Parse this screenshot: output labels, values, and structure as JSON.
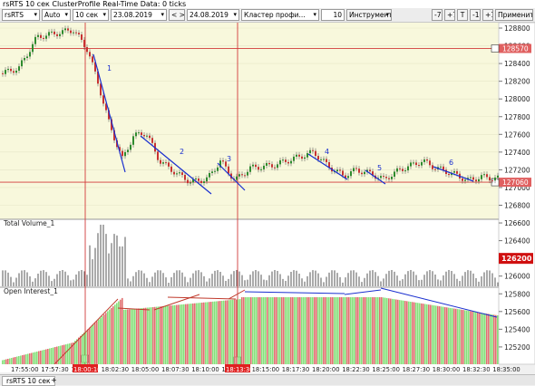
{
  "window": {
    "title": "rsRTS 10 сек ClusterProfile Real-Time Data: 0 ticks"
  },
  "toolbar": {
    "instrument": "rsRTS",
    "mode": "Auto",
    "timeframe": "10 сек",
    "date_from": "23.08.2019",
    "nav": "< >",
    "date_to": "24.08.2019",
    "indicator": "Кластер профи...",
    "count": "10",
    "tools_label": "Инструменты",
    "btn_minus7": "-7",
    "btn_plus7": "+7",
    "btn_t": "T",
    "btn_minus1": "-1",
    "btn_plus1": "+1",
    "apply_label": "Применить"
  },
  "chart": {
    "price_labels": [
      "128800",
      "128600",
      "128400",
      "128200",
      "128000",
      "127800",
      "127600",
      "127400",
      "127200",
      "127000",
      "126800",
      "126600",
      "126400",
      "126200",
      "126000",
      "125800",
      "125600",
      "125400",
      "125200"
    ],
    "price_values": [
      128800,
      128600,
      128400,
      128200,
      128000,
      127800,
      127600,
      127400,
      127200,
      127000,
      126800,
      126600,
      126400,
      126200,
      126000,
      125800,
      125600,
      125400,
      125200
    ],
    "highlight_upper": "128570",
    "highlight_upper_value": 128570,
    "highlight_lower": "127060",
    "highlight_lower_value": 127060,
    "highlight_volume": "126200",
    "price_line_color": "#d23a3a",
    "panel_volume_label": "Total Volume_1",
    "panel_oi_label": "Open Interest_1",
    "trend_labels": [
      "1",
      "2",
      "3",
      "4",
      "5",
      "6"
    ],
    "time_labels": [
      "17:55:00",
      "17:57:30",
      "18:00:10",
      "18:02:30",
      "18:05:00",
      "18:07:30",
      "18:10:00",
      "18:12:30",
      "18:15:00",
      "18:17:30",
      "18:20:00",
      "18:22:30",
      "18:25:00",
      "18:27:30",
      "18:30:00",
      "18:32:30",
      "18:35:00"
    ],
    "time_marker_1": "18:00:10",
    "time_marker_2": "18:13:30",
    "colors": {
      "bg_price": "#f8f8dc",
      "bull": "#2e8b2e",
      "bear": "#c83232",
      "trend": "#1a2fd0",
      "oi_up": "#86e07a",
      "oi_down": "#e07070"
    }
  },
  "statusbar": {
    "tab_label": "rsRTS 10 сек",
    "add_tab": "+"
  }
}
